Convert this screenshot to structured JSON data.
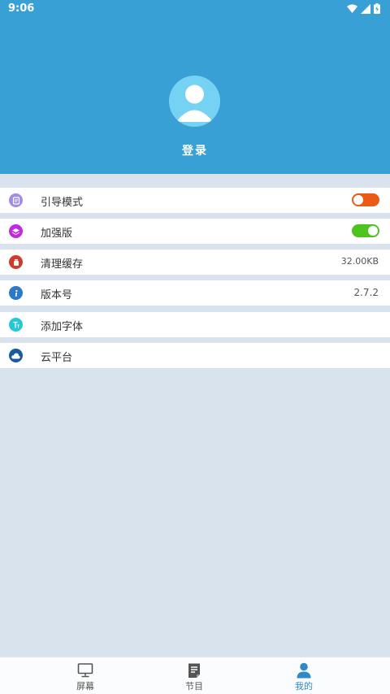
{
  "status_bar": {
    "time": "9:06"
  },
  "profile": {
    "login_label": "登录"
  },
  "settings": {
    "guide_mode": {
      "label": "引导模式",
      "enabled": false,
      "toggle_color": "#ec5a18"
    },
    "enhanced": {
      "label": "加强版",
      "enabled": true,
      "toggle_color": "#4dc41e"
    },
    "clear_cache": {
      "label": "清理缓存",
      "value": "32.00KB"
    },
    "version": {
      "label": "版本号",
      "value": "2.7.2"
    },
    "add_font": {
      "label": "添加字体"
    },
    "cloud": {
      "label": "云平台"
    }
  },
  "tabs": [
    {
      "label": "屏幕",
      "icon": "monitor-icon",
      "active": false
    },
    {
      "label": "节目",
      "icon": "program-icon",
      "active": false
    },
    {
      "label": "我的",
      "icon": "person-icon",
      "active": true
    }
  ],
  "colors": {
    "header": "#39a0d6",
    "background": "#d9e3ee",
    "active_tab": "#2d8ac6"
  }
}
